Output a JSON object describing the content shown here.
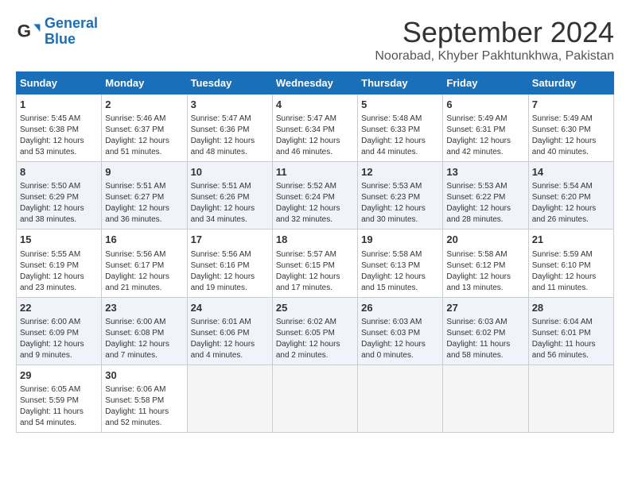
{
  "logo": {
    "text_general": "General",
    "text_blue": "Blue"
  },
  "title": "September 2024",
  "location": "Noorabad, Khyber Pakhtunkhwa, Pakistan",
  "weekdays": [
    "Sunday",
    "Monday",
    "Tuesday",
    "Wednesday",
    "Thursday",
    "Friday",
    "Saturday"
  ],
  "weeks": [
    [
      {
        "day": "1",
        "info": "Sunrise: 5:45 AM\nSunset: 6:38 PM\nDaylight: 12 hours\nand 53 minutes."
      },
      {
        "day": "2",
        "info": "Sunrise: 5:46 AM\nSunset: 6:37 PM\nDaylight: 12 hours\nand 51 minutes."
      },
      {
        "day": "3",
        "info": "Sunrise: 5:47 AM\nSunset: 6:36 PM\nDaylight: 12 hours\nand 48 minutes."
      },
      {
        "day": "4",
        "info": "Sunrise: 5:47 AM\nSunset: 6:34 PM\nDaylight: 12 hours\nand 46 minutes."
      },
      {
        "day": "5",
        "info": "Sunrise: 5:48 AM\nSunset: 6:33 PM\nDaylight: 12 hours\nand 44 minutes."
      },
      {
        "day": "6",
        "info": "Sunrise: 5:49 AM\nSunset: 6:31 PM\nDaylight: 12 hours\nand 42 minutes."
      },
      {
        "day": "7",
        "info": "Sunrise: 5:49 AM\nSunset: 6:30 PM\nDaylight: 12 hours\nand 40 minutes."
      }
    ],
    [
      {
        "day": "8",
        "info": "Sunrise: 5:50 AM\nSunset: 6:29 PM\nDaylight: 12 hours\nand 38 minutes."
      },
      {
        "day": "9",
        "info": "Sunrise: 5:51 AM\nSunset: 6:27 PM\nDaylight: 12 hours\nand 36 minutes."
      },
      {
        "day": "10",
        "info": "Sunrise: 5:51 AM\nSunset: 6:26 PM\nDaylight: 12 hours\nand 34 minutes."
      },
      {
        "day": "11",
        "info": "Sunrise: 5:52 AM\nSunset: 6:24 PM\nDaylight: 12 hours\nand 32 minutes."
      },
      {
        "day": "12",
        "info": "Sunrise: 5:53 AM\nSunset: 6:23 PM\nDaylight: 12 hours\nand 30 minutes."
      },
      {
        "day": "13",
        "info": "Sunrise: 5:53 AM\nSunset: 6:22 PM\nDaylight: 12 hours\nand 28 minutes."
      },
      {
        "day": "14",
        "info": "Sunrise: 5:54 AM\nSunset: 6:20 PM\nDaylight: 12 hours\nand 26 minutes."
      }
    ],
    [
      {
        "day": "15",
        "info": "Sunrise: 5:55 AM\nSunset: 6:19 PM\nDaylight: 12 hours\nand 23 minutes."
      },
      {
        "day": "16",
        "info": "Sunrise: 5:56 AM\nSunset: 6:17 PM\nDaylight: 12 hours\nand 21 minutes."
      },
      {
        "day": "17",
        "info": "Sunrise: 5:56 AM\nSunset: 6:16 PM\nDaylight: 12 hours\nand 19 minutes."
      },
      {
        "day": "18",
        "info": "Sunrise: 5:57 AM\nSunset: 6:15 PM\nDaylight: 12 hours\nand 17 minutes."
      },
      {
        "day": "19",
        "info": "Sunrise: 5:58 AM\nSunset: 6:13 PM\nDaylight: 12 hours\nand 15 minutes."
      },
      {
        "day": "20",
        "info": "Sunrise: 5:58 AM\nSunset: 6:12 PM\nDaylight: 12 hours\nand 13 minutes."
      },
      {
        "day": "21",
        "info": "Sunrise: 5:59 AM\nSunset: 6:10 PM\nDaylight: 12 hours\nand 11 minutes."
      }
    ],
    [
      {
        "day": "22",
        "info": "Sunrise: 6:00 AM\nSunset: 6:09 PM\nDaylight: 12 hours\nand 9 minutes."
      },
      {
        "day": "23",
        "info": "Sunrise: 6:00 AM\nSunset: 6:08 PM\nDaylight: 12 hours\nand 7 minutes."
      },
      {
        "day": "24",
        "info": "Sunrise: 6:01 AM\nSunset: 6:06 PM\nDaylight: 12 hours\nand 4 minutes."
      },
      {
        "day": "25",
        "info": "Sunrise: 6:02 AM\nSunset: 6:05 PM\nDaylight: 12 hours\nand 2 minutes."
      },
      {
        "day": "26",
        "info": "Sunrise: 6:03 AM\nSunset: 6:03 PM\nDaylight: 12 hours\nand 0 minutes."
      },
      {
        "day": "27",
        "info": "Sunrise: 6:03 AM\nSunset: 6:02 PM\nDaylight: 11 hours\nand 58 minutes."
      },
      {
        "day": "28",
        "info": "Sunrise: 6:04 AM\nSunset: 6:01 PM\nDaylight: 11 hours\nand 56 minutes."
      }
    ],
    [
      {
        "day": "29",
        "info": "Sunrise: 6:05 AM\nSunset: 5:59 PM\nDaylight: 11 hours\nand 54 minutes."
      },
      {
        "day": "30",
        "info": "Sunrise: 6:06 AM\nSunset: 5:58 PM\nDaylight: 11 hours\nand 52 minutes."
      },
      null,
      null,
      null,
      null,
      null
    ]
  ]
}
